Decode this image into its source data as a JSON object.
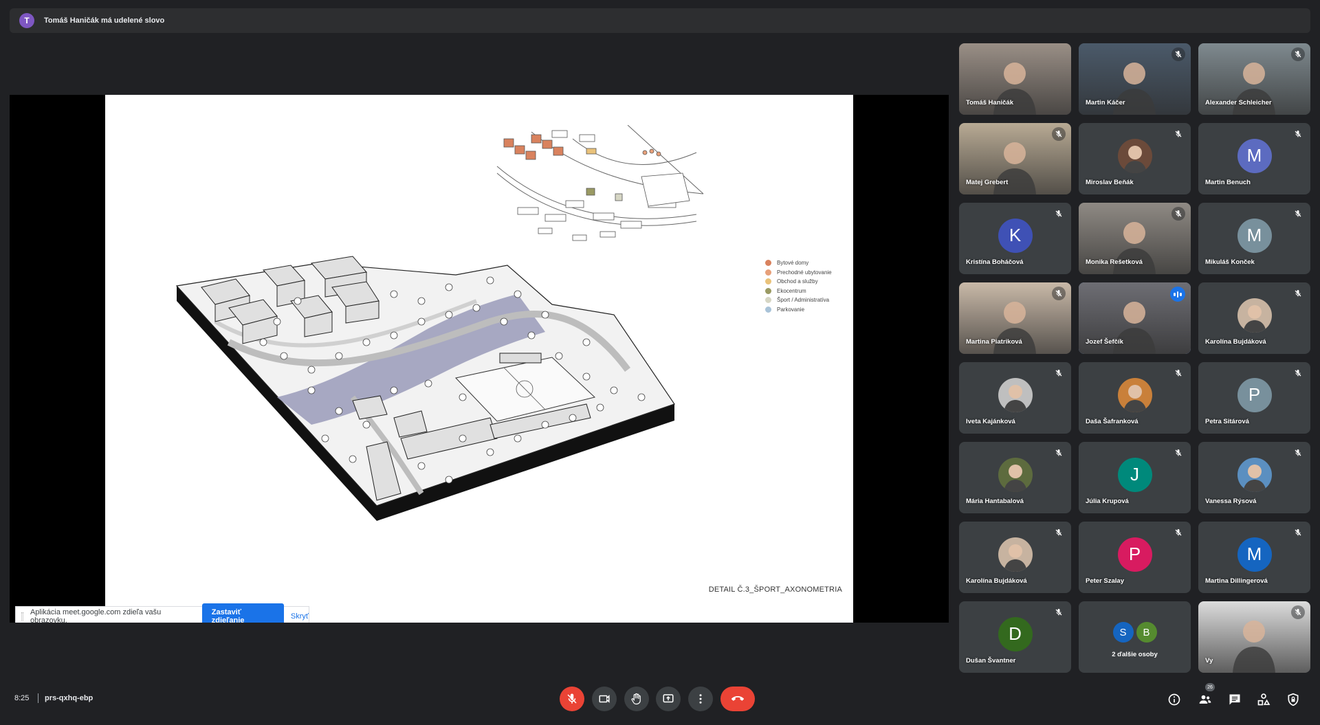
{
  "notification": {
    "avatar_letter": "T",
    "text": "Tomáš Haničák má udelené slovo"
  },
  "presentation": {
    "caption": "DETAIL Č.3_ŠPORT_AXONOMETRIA",
    "legend": [
      {
        "label": "Bytové domy",
        "color": "#d9825e"
      },
      {
        "label": "Prechodné ubytovanie",
        "color": "#e7a07a"
      },
      {
        "label": "Obchod a služby",
        "color": "#e9c27a"
      },
      {
        "label": "Ekocentrum",
        "color": "#9a9a63"
      },
      {
        "label": "Šport / Administratíva",
        "color": "#d6d6c4"
      },
      {
        "label": "Parkovanie",
        "color": "#a9c3d8"
      }
    ],
    "share_banner": {
      "text": "Aplikácia meet.google.com zdieľa vašu obrazovku.",
      "stop_label": "Zastaviť zdieľanie",
      "hide_label": "Skryť"
    }
  },
  "participants": [
    {
      "name": "Tomáš Haničák",
      "kind": "video",
      "muted": false,
      "bg": "#9a8f86"
    },
    {
      "name": "Martin Káčer",
      "kind": "video",
      "muted": true,
      "bg": "#4b5a6a"
    },
    {
      "name": "Alexander Schleicher",
      "kind": "video",
      "muted": true,
      "bg": "#7f8a8f"
    },
    {
      "name": "Matej Grebert",
      "kind": "video",
      "muted": true,
      "bg": "#b8aa94"
    },
    {
      "name": "Miroslav Beňák",
      "kind": "photo",
      "muted": true,
      "bg": "#6b4a3a"
    },
    {
      "name": "Martin Benuch",
      "kind": "letter",
      "letter": "M",
      "muted": true,
      "bg": "#5c6bc0"
    },
    {
      "name": "Kristína Boháčová",
      "kind": "letter",
      "letter": "K",
      "muted": true,
      "bg": "#3f51b5"
    },
    {
      "name": "Monika Rešetková",
      "kind": "video",
      "muted": true,
      "bg": "#8f8a84"
    },
    {
      "name": "Mikuláš Konček",
      "kind": "letter",
      "letter": "M",
      "muted": true,
      "bg": "#78909c"
    },
    {
      "name": "Martina Piatriková",
      "kind": "video",
      "muted": true,
      "bg": "#c9b9a8"
    },
    {
      "name": "Jozef Šefčík",
      "kind": "video",
      "muted": false,
      "speaking": true,
      "bg": "#6e6e74"
    },
    {
      "name": "Karolína Bujdáková",
      "kind": "photo",
      "muted": true,
      "bg": "#c7b3a0"
    },
    {
      "name": "Iveta Kajánková",
      "kind": "photo",
      "muted": true,
      "bg": "#bfbfbf"
    },
    {
      "name": "Daša Šafranková",
      "kind": "photo",
      "muted": true,
      "bg": "#c9803a"
    },
    {
      "name": "Petra Sitárová",
      "kind": "letter",
      "letter": "P",
      "muted": true,
      "bg": "#78909c"
    },
    {
      "name": "Mária Hantabalová",
      "kind": "photo",
      "muted": true,
      "bg": "#5d6b3e"
    },
    {
      "name": "Júlia Krupová",
      "kind": "letter",
      "letter": "J",
      "muted": true,
      "bg": "#00897b"
    },
    {
      "name": "Vanessa Rýsová",
      "kind": "photo",
      "muted": true,
      "bg": "#5b8fc0"
    },
    {
      "name": "Karolína Bujdáková",
      "kind": "photo",
      "muted": true,
      "bg": "#c7b3a0"
    },
    {
      "name": "Peter Szalay",
      "kind": "letter",
      "letter": "P",
      "muted": true,
      "bg": "#d81b60"
    },
    {
      "name": "Martina Dillingerová",
      "kind": "letter",
      "letter": "M",
      "muted": true,
      "bg": "#1565c0"
    },
    {
      "name": "Dušan Švantner",
      "kind": "letter",
      "letter": "D",
      "muted": true,
      "bg": "#33691e"
    },
    {
      "name": "2 ďalšie osoby",
      "kind": "more",
      "letters": [
        "S",
        "B"
      ],
      "colors": [
        "#1565c0",
        "#558b2f"
      ],
      "muted": false
    },
    {
      "name": "Vy",
      "kind": "video",
      "muted": true,
      "bg": "#dcdcdc"
    }
  ],
  "footer": {
    "time": "8:25",
    "meeting_code": "prs-qxhq-ebp",
    "people_count": "26"
  }
}
